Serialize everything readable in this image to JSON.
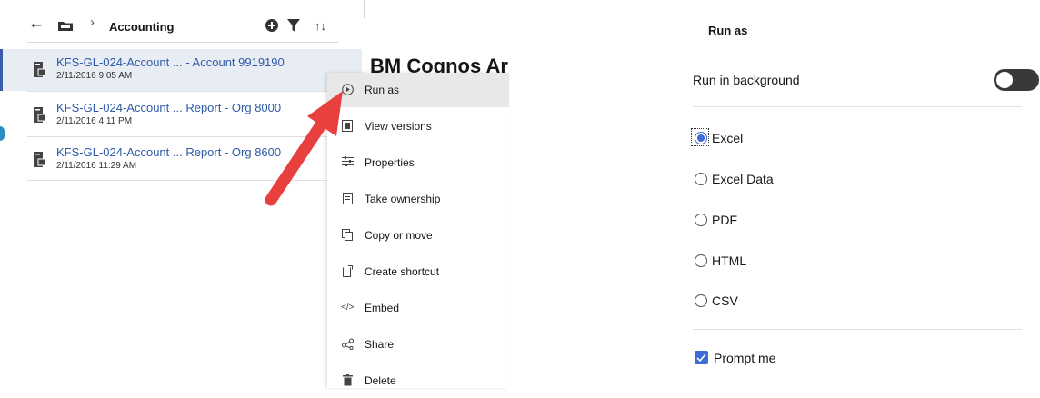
{
  "breadcrumb": {
    "folder": "Accounting"
  },
  "files": [
    {
      "name": "KFS-GL-024-Account ... - Account 9919190",
      "date": "2/11/2016 9:05 AM"
    },
    {
      "name": "KFS-GL-024-Account ... Report - Org 8000",
      "date": "2/11/2016 4:11 PM"
    },
    {
      "name": "KFS-GL-024-Account ... Report - Org 8600",
      "date": "2/11/2016 11:29 AM"
    }
  ],
  "context_menu": {
    "items": [
      {
        "label": "Run as",
        "icon": "play-circle-icon"
      },
      {
        "label": "View versions",
        "icon": "versions-icon"
      },
      {
        "label": "Properties",
        "icon": "sliders-icon"
      },
      {
        "label": "Take ownership",
        "icon": "ownership-icon"
      },
      {
        "label": "Copy or move",
        "icon": "copy-icon"
      },
      {
        "label": "Create shortcut",
        "icon": "shortcut-icon"
      },
      {
        "label": "Embed",
        "icon": "code-icon"
      },
      {
        "label": "Share",
        "icon": "share-icon"
      },
      {
        "label": "Delete",
        "icon": "trash-icon"
      }
    ]
  },
  "background_title": "BM Cognos Ar",
  "run_as": {
    "title": "Run as",
    "run_in_background_label": "Run in background",
    "run_in_background": false,
    "formats": [
      "Excel",
      "Excel Data",
      "PDF",
      "HTML",
      "CSV"
    ],
    "selected_format": "Excel",
    "prompt_me_label": "Prompt me",
    "prompt_me": true
  },
  "colors": {
    "accent": "#3d6bd6",
    "link": "#2f5aa8",
    "arrow": "#e8403e",
    "toggle_off": "#393939"
  }
}
